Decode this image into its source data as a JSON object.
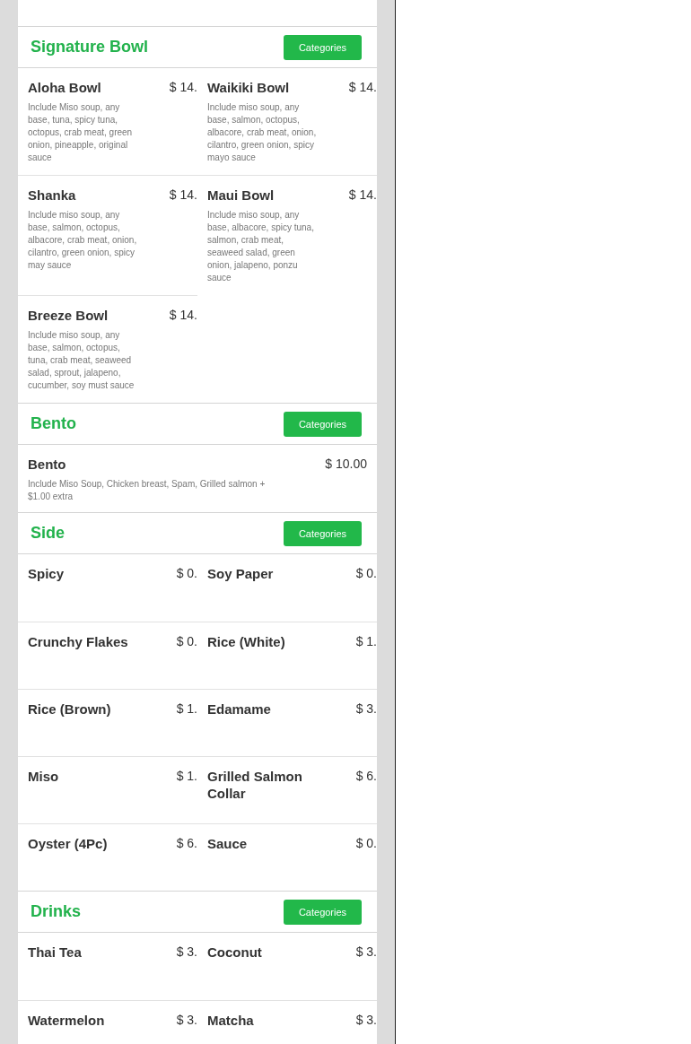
{
  "sections": [
    {
      "title": "Signature Bowl",
      "button": "Categories",
      "kind": "grid",
      "items": [
        {
          "name": "Aloha Bowl",
          "price": "$ 14.",
          "description": "Include Miso soup, any base, tuna, spicy tuna, octopus, crab meat, green onion, pineapple, original sauce"
        },
        {
          "name": "Waikiki Bowl",
          "price": "$ 14.",
          "description": "Include miso soup, any base, salmon, octopus, albacore, crab meat, onion, cilantro, green onion, spicy mayo sauce"
        },
        {
          "name": "Shanka",
          "price": "$ 14.",
          "description": "Include miso soup, any base, salmon, octopus, albacore, crab meat, onion, cilantro, green onion, spicy may sauce"
        },
        {
          "name": "Maui Bowl",
          "price": "$ 14.",
          "description": "Include miso soup, any base, albacore, spicy tuna, salmon, crab meat, seaweed salad, green onion, jalapeno, ponzu sauce"
        },
        {
          "name": "Breeze Bowl",
          "price": "$ 14.",
          "description": "Include miso soup, any base, salmon, octopus, tuna, crab meat, seaweed salad, sprout, jalapeno, cucumber, soy must sauce"
        }
      ]
    },
    {
      "title": "Bento",
      "button": "Categories",
      "kind": "list",
      "items": [
        {
          "name": "Bento",
          "price": "$ 10.00",
          "description": "Include Miso Soup, Chicken breast, Spam, Grilled salmon + $1.00 extra"
        }
      ]
    },
    {
      "title": "Side",
      "button": "Categories",
      "kind": "grid",
      "items": [
        {
          "name": "Spicy",
          "price": "$ 0."
        },
        {
          "name": "Soy Paper",
          "price": "$ 0."
        },
        {
          "name": "Crunchy Flakes",
          "price": "$ 0."
        },
        {
          "name": "Rice (White)",
          "price": "$ 1."
        },
        {
          "name": "Rice (Brown)",
          "price": "$ 1."
        },
        {
          "name": "Edamame",
          "price": "$ 3."
        },
        {
          "name": "Miso",
          "price": "$ 1."
        },
        {
          "name": "Grilled Salmon Collar",
          "price": "$ 6."
        },
        {
          "name": "Oyster (4Pc)",
          "price": "$ 6."
        },
        {
          "name": "Sauce",
          "price": "$ 0."
        }
      ]
    },
    {
      "title": "Drinks",
      "button": "Categories",
      "kind": "grid",
      "items": [
        {
          "name": "Thai Tea",
          "price": "$ 3."
        },
        {
          "name": "Coconut",
          "price": "$ 3."
        },
        {
          "name": "Watermelon",
          "price": "$ 3."
        },
        {
          "name": "Matcha",
          "price": "$ 3."
        }
      ]
    }
  ]
}
